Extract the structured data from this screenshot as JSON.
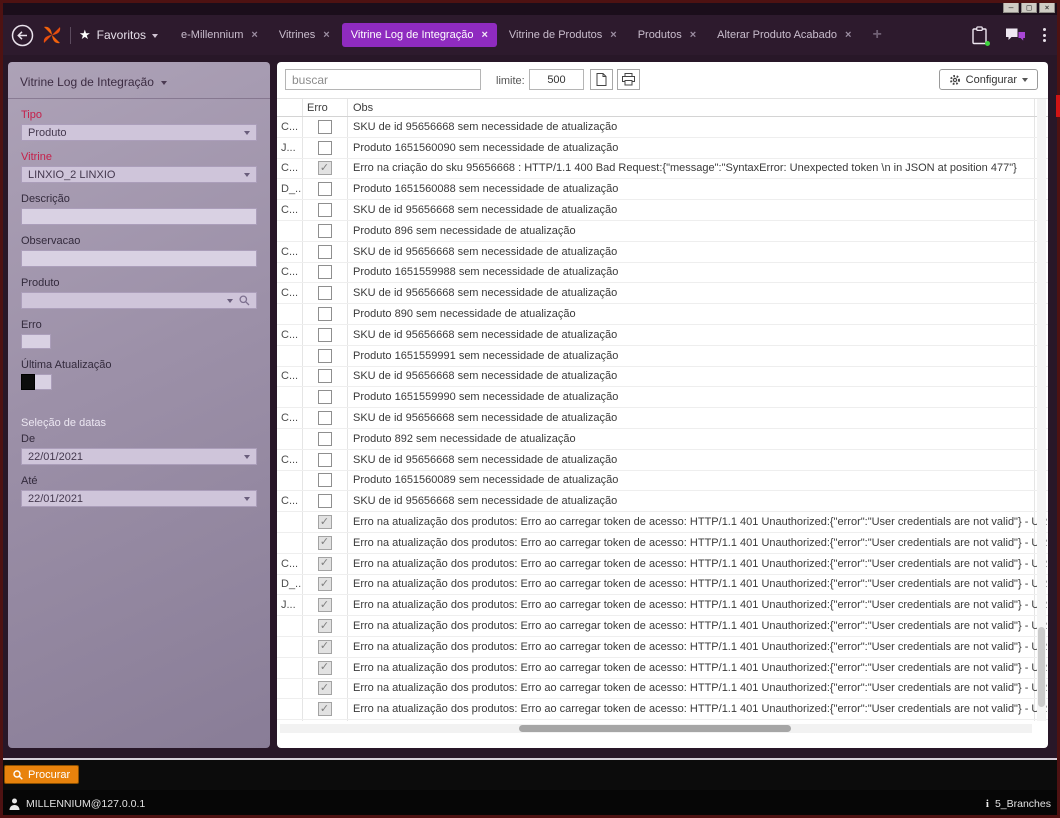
{
  "colors": {
    "active_tab_purple": "#8f2bbf",
    "label_red": "#c5204a",
    "procurar_orange": "#e8820c",
    "navbar_purple": "#2d1a2d"
  },
  "icons": {
    "star": "★",
    "tab_close": "×",
    "new_tab": "+",
    "minimize": "–",
    "maximize": "□",
    "close": "×",
    "info": "i"
  },
  "navbar": {
    "favorites_label": "Favoritos",
    "tabs": [
      {
        "label": "e-Millennium",
        "active": false
      },
      {
        "label": "Vitrines",
        "active": false
      },
      {
        "label": "Vitrine Log de Integração",
        "active": true
      },
      {
        "label": "Vitrine de Produtos",
        "active": false
      },
      {
        "label": "Produtos",
        "active": false
      },
      {
        "label": "Alterar Produto Acabado",
        "active": false
      }
    ]
  },
  "sidebar": {
    "title": "Vitrine Log de Integração",
    "tipo": {
      "label": "Tipo",
      "value": "Produto"
    },
    "vitrine": {
      "label": "Vitrine",
      "value": "LINXIO_2 LINXIO"
    },
    "descricao": {
      "label": "Descrição",
      "value": ""
    },
    "observacao": {
      "label": "Observacao",
      "value": ""
    },
    "produto": {
      "label": "Produto",
      "value": ""
    },
    "erro_label": "Erro",
    "ultima_atualizacao_label": "Última Atualização",
    "selecao_datas_label": "Seleção de datas",
    "de": {
      "label": "De",
      "value": "22/01/2021"
    },
    "ate": {
      "label": "Até",
      "value": "22/01/2021"
    }
  },
  "toolbar": {
    "search_placeholder": "buscar",
    "limit_label": "limite:",
    "limit_value": "500",
    "configure_label": "Configurar"
  },
  "table": {
    "columns": {
      "erro": "Erro",
      "obs": "Obs"
    },
    "rows": [
      {
        "c1": "C...",
        "checked": false,
        "obs": "SKU de id 95656668 sem necessidade de atualização"
      },
      {
        "c1": "J...",
        "checked": false,
        "obs": "Produto 1651560090 sem necessidade de atualização"
      },
      {
        "c1": "C...",
        "checked": true,
        "obs": "Erro na criação do sku 95656668 : HTTP/1.1 400 Bad Request:{\"message\":\"SyntaxError: Unexpected token \\n in JSON at position 477\"}"
      },
      {
        "c1": "D_...",
        "checked": false,
        "obs": "Produto 1651560088 sem necessidade de atualização"
      },
      {
        "c1": "C...",
        "checked": false,
        "obs": "SKU de id 95656668 sem necessidade de atualização"
      },
      {
        "c1": "",
        "checked": false,
        "obs": "Produto 896 sem necessidade de atualização"
      },
      {
        "c1": "C...",
        "checked": false,
        "obs": "SKU de id 95656668 sem necessidade de atualização"
      },
      {
        "c1": "C...",
        "checked": false,
        "obs": "Produto 1651559988 sem necessidade de atualização"
      },
      {
        "c1": "C...",
        "checked": false,
        "obs": "SKU de id 95656668 sem necessidade de atualização"
      },
      {
        "c1": "",
        "checked": false,
        "obs": "Produto 890 sem necessidade de atualização"
      },
      {
        "c1": "C...",
        "checked": false,
        "obs": "SKU de id 95656668 sem necessidade de atualização"
      },
      {
        "c1": "",
        "checked": false,
        "obs": "Produto 1651559991 sem necessidade de atualização"
      },
      {
        "c1": "C...",
        "checked": false,
        "obs": "SKU de id 95656668 sem necessidade de atualização"
      },
      {
        "c1": "",
        "checked": false,
        "obs": "Produto 1651559990 sem necessidade de atualização"
      },
      {
        "c1": "C...",
        "checked": false,
        "obs": "SKU de id 95656668 sem necessidade de atualização"
      },
      {
        "c1": "",
        "checked": false,
        "obs": "Produto 892 sem necessidade de atualização"
      },
      {
        "c1": "C...",
        "checked": false,
        "obs": "SKU de id 95656668 sem necessidade de atualização"
      },
      {
        "c1": "",
        "checked": false,
        "obs": "Produto 1651560089 sem necessidade de atualização"
      },
      {
        "c1": "C...",
        "checked": false,
        "obs": "SKU de id 95656668 sem necessidade de atualização"
      },
      {
        "c1": "",
        "checked": true,
        "obs": "Erro na atualização dos produtos: Erro ao carregar token de acesso: HTTP/1.1 401 Unauthorized:{\"error\":\"User credentials are not valid\"} - URL https://api.l..."
      },
      {
        "c1": "",
        "checked": true,
        "obs": "Erro na atualização dos produtos: Erro ao carregar token de acesso: HTTP/1.1 401 Unauthorized:{\"error\":\"User credentials are not valid\"} - URL https://api.l..."
      },
      {
        "c1": "C...",
        "checked": true,
        "obs": "Erro na atualização dos produtos: Erro ao carregar token de acesso: HTTP/1.1 401 Unauthorized:{\"error\":\"User credentials are not valid\"} - URL https://api.l..."
      },
      {
        "c1": "D_...",
        "checked": true,
        "obs": "Erro na atualização dos produtos: Erro ao carregar token de acesso: HTTP/1.1 401 Unauthorized:{\"error\":\"User credentials are not valid\"} - URL https://api.l..."
      },
      {
        "c1": "J...",
        "checked": true,
        "obs": "Erro na atualização dos produtos: Erro ao carregar token de acesso: HTTP/1.1 401 Unauthorized:{\"error\":\"User credentials are not valid\"} - URL https://api.l..."
      },
      {
        "c1": "",
        "checked": true,
        "obs": "Erro na atualização dos produtos: Erro ao carregar token de acesso: HTTP/1.1 401 Unauthorized:{\"error\":\"User credentials are not valid\"} - URL https://api.l..."
      },
      {
        "c1": "",
        "checked": true,
        "obs": "Erro na atualização dos produtos: Erro ao carregar token de acesso: HTTP/1.1 401 Unauthorized:{\"error\":\"User credentials are not valid\"} - URL https://api.l..."
      },
      {
        "c1": "",
        "checked": true,
        "obs": "Erro na atualização dos produtos: Erro ao carregar token de acesso: HTTP/1.1 401 Unauthorized:{\"error\":\"User credentials are not valid\"} - URL https://api.l..."
      },
      {
        "c1": "",
        "checked": true,
        "obs": "Erro na atualização dos produtos: Erro ao carregar token de acesso: HTTP/1.1 401 Unauthorized:{\"error\":\"User credentials are not valid\"} - URL https://api.l..."
      },
      {
        "c1": "",
        "checked": true,
        "obs": "Erro na atualização dos produtos: Erro ao carregar token de acesso: HTTP/1.1 401 Unauthorized:{\"error\":\"User credentials are not valid\"} - URL https://api.l..."
      }
    ]
  },
  "footer": {
    "procurar_label": "Procurar",
    "user": "MILLENNIUM@127.0.0.1",
    "branches": "5_Branches"
  }
}
